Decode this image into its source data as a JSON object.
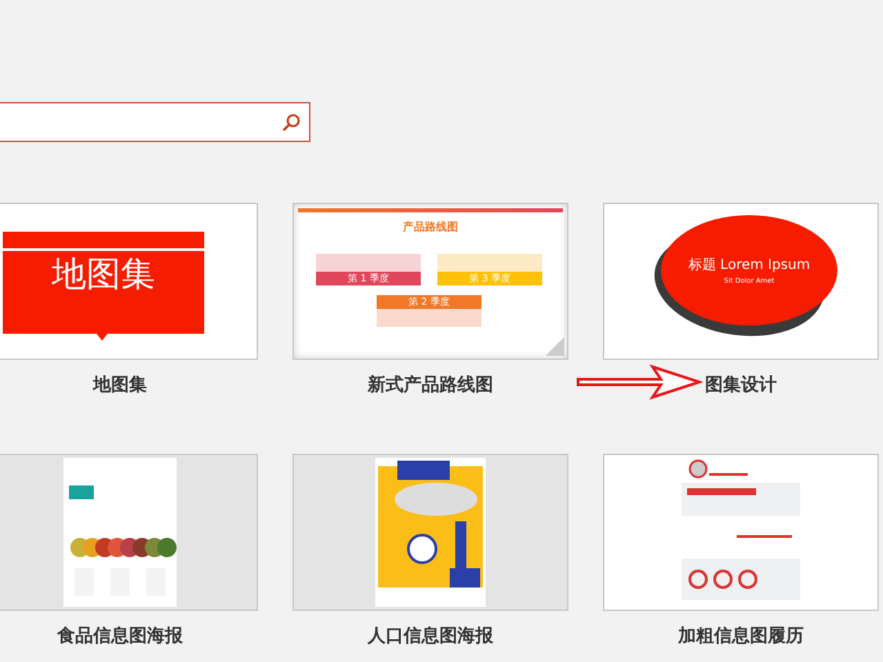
{
  "templates": [
    {
      "kind": "map-banner",
      "label": "地图集",
      "thumb_title": "地图集"
    },
    {
      "kind": "roadmap",
      "label": "新式产品路线图",
      "thumb_title": "产品路线图",
      "quarters": [
        "第 1 季度",
        "第 3 季度",
        "第 2 季度"
      ]
    },
    {
      "kind": "oval",
      "label": "图集设计",
      "thumb_title": "标题 Lorem Ipsum",
      "thumb_subtitle": "Sit Dolor Amet",
      "pointed": true
    },
    {
      "kind": "food-poster",
      "label": "食品信息图海报"
    },
    {
      "kind": "population-poster",
      "label": "人口信息图海报"
    },
    {
      "kind": "resume-poster",
      "label": "加粗信息图履历"
    }
  ]
}
